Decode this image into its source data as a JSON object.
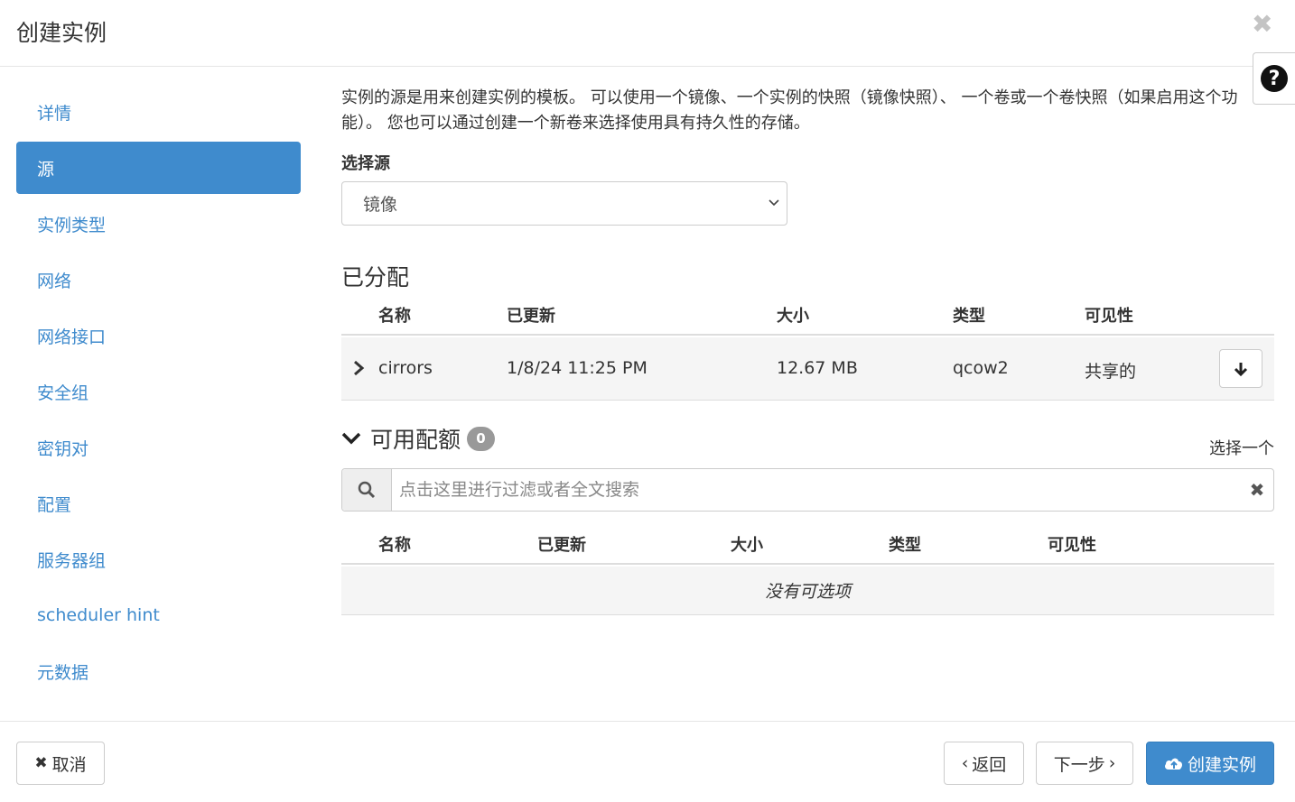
{
  "header": {
    "title": "创建实例",
    "close_glyph": "✖"
  },
  "help": {
    "glyph": "?"
  },
  "sidebar": {
    "items": [
      {
        "label": "详情",
        "active": false
      },
      {
        "label": "源",
        "active": true
      },
      {
        "label": "实例类型",
        "active": false
      },
      {
        "label": "网络",
        "active": false
      },
      {
        "label": "网络接口",
        "active": false
      },
      {
        "label": "安全组",
        "active": false
      },
      {
        "label": "密钥对",
        "active": false
      },
      {
        "label": "配置",
        "active": false
      },
      {
        "label": "服务器组",
        "active": false
      },
      {
        "label": "scheduler hint",
        "active": false
      },
      {
        "label": "元数据",
        "active": false
      }
    ]
  },
  "source": {
    "description": "实例的源是用来创建实例的模板。 可以使用一个镜像、一个实例的快照（镜像快照）、 一个卷或一个卷快照（如果启用这个功能）。 您也可以通过创建一个新卷来选择使用具有持久性的存储。",
    "select_label": "选择源",
    "select_value": "镜像"
  },
  "allocated": {
    "title": "已分配",
    "columns": [
      "名称",
      "已更新",
      "大小",
      "类型",
      "可见性"
    ],
    "rows": [
      {
        "name": "cirrors",
        "updated": "1/8/24 11:25 PM",
        "size": "12.67 MB",
        "type": "qcow2",
        "visibility": "共享的"
      }
    ]
  },
  "available": {
    "title": "可用配额",
    "count": "0",
    "select_one": "选择一个",
    "search_placeholder": "点击这里进行过滤或者全文搜索",
    "columns": [
      "名称",
      "已更新",
      "大小",
      "类型",
      "可见性"
    ],
    "empty_text": "没有可选项"
  },
  "footer": {
    "cancel": "取消",
    "back": "返回",
    "next": "下一步",
    "create": "创建实例"
  },
  "colors": {
    "accent": "#3f8bcd",
    "badge": "#999999"
  }
}
